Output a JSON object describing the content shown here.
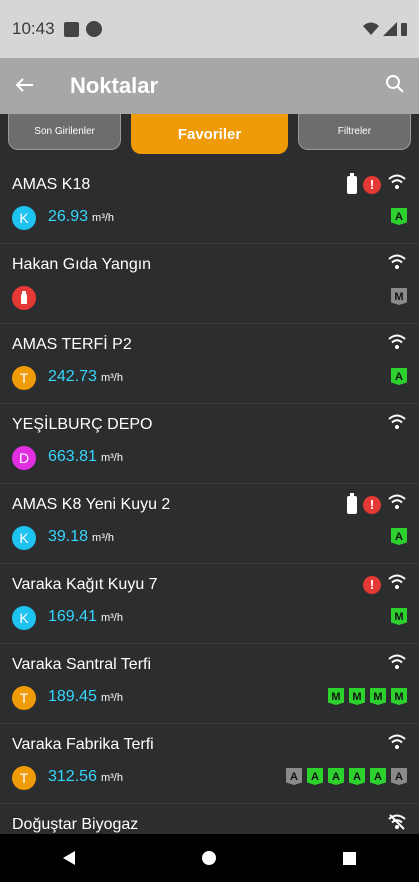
{
  "status_bar": {
    "time": "10:43"
  },
  "app_bar": {
    "title": "Noktalar"
  },
  "tabs": [
    {
      "label": "Son Girilenler",
      "active": false
    },
    {
      "label": "Favoriler",
      "active": true
    },
    {
      "label": "Filtreler",
      "active": false
    }
  ],
  "items": [
    {
      "name": "AMAS K18",
      "type": "K",
      "type_color": "#1ec3f2",
      "value": "26.93",
      "unit": "m³/h",
      "value_color": "#36d6ff",
      "battery": true,
      "alert": true,
      "signal": "on",
      "tags": [
        {
          "letter": "A",
          "color": "#2dd12d"
        }
      ]
    },
    {
      "name": "Hakan Gıda Yangın",
      "type": "fire",
      "type_color": "#e53935",
      "value": "",
      "unit": "",
      "value_color": "#36d6ff",
      "battery": false,
      "alert": false,
      "signal": "on",
      "tags": [
        {
          "letter": "M",
          "color": "#8a8a8a"
        }
      ]
    },
    {
      "name": "AMAS TERFİ P2",
      "type": "T",
      "type_color": "#ef9a08",
      "value": "242.73",
      "unit": "m³/h",
      "value_color": "#36d6ff",
      "battery": false,
      "alert": false,
      "signal": "on",
      "tags": [
        {
          "letter": "A",
          "color": "#2dd12d"
        }
      ]
    },
    {
      "name": "YEŞİLBURÇ DEPO",
      "type": "D",
      "type_color": "#e02ee0",
      "value": "663.81",
      "unit": "m³/h",
      "value_color": "#36d6ff",
      "battery": false,
      "alert": false,
      "signal": "on",
      "tags": []
    },
    {
      "name": "AMAS K8 Yeni Kuyu 2",
      "type": "K",
      "type_color": "#1ec3f2",
      "value": "39.18",
      "unit": "m³/h",
      "value_color": "#36d6ff",
      "battery": true,
      "alert": true,
      "signal": "on",
      "tags": [
        {
          "letter": "A",
          "color": "#2dd12d"
        }
      ]
    },
    {
      "name": "Varaka Kağıt Kuyu 7",
      "type": "K",
      "type_color": "#1ec3f2",
      "value": "169.41",
      "unit": "m³/h",
      "value_color": "#36d6ff",
      "battery": false,
      "alert": true,
      "signal": "on",
      "tags": [
        {
          "letter": "M",
          "color": "#2dd12d"
        }
      ]
    },
    {
      "name": "Varaka Santral Terfi",
      "type": "T",
      "type_color": "#ef9a08",
      "value": "189.45",
      "unit": "m³/h",
      "value_color": "#36d6ff",
      "battery": false,
      "alert": false,
      "signal": "on",
      "tags": [
        {
          "letter": "M",
          "color": "#2dd12d"
        },
        {
          "letter": "M",
          "color": "#2dd12d"
        },
        {
          "letter": "M",
          "color": "#2dd12d"
        },
        {
          "letter": "M",
          "color": "#2dd12d"
        }
      ]
    },
    {
      "name": "Varaka Fabrika Terfi",
      "type": "T",
      "type_color": "#ef9a08",
      "value": "312.56",
      "unit": "m³/h",
      "value_color": "#36d6ff",
      "battery": false,
      "alert": false,
      "signal": "on",
      "tags": [
        {
          "letter": "A",
          "color": "#8a8a8a"
        },
        {
          "letter": "A",
          "color": "#2dd12d"
        },
        {
          "letter": "A",
          "color": "#2dd12d"
        },
        {
          "letter": "A",
          "color": "#2dd12d"
        },
        {
          "letter": "A",
          "color": "#2dd12d"
        },
        {
          "letter": "A",
          "color": "#8a8a8a"
        }
      ]
    },
    {
      "name": "Doğuştar Biyogaz",
      "type": "",
      "type_color": "#2b2d2e",
      "value": "",
      "unit": "",
      "value_color": "#36d6ff",
      "battery": false,
      "alert": false,
      "signal": "off",
      "tags": []
    }
  ],
  "icons": {
    "back": "arrow-left-icon",
    "search": "search-icon",
    "signal": "wifi-icon",
    "battery": "battery-icon",
    "alert": "alert-icon"
  }
}
